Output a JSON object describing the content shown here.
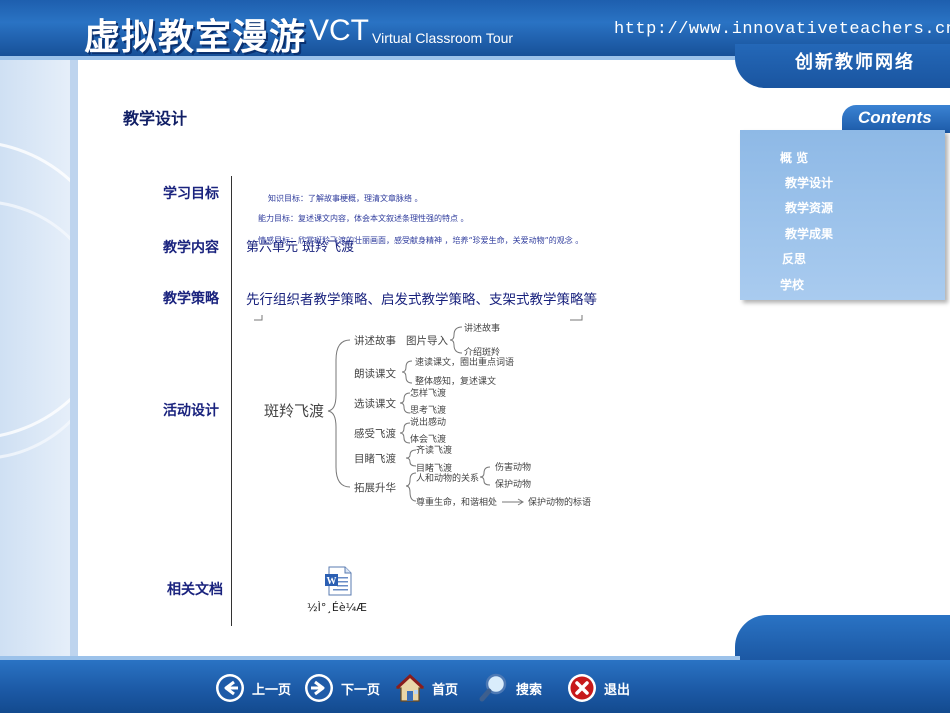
{
  "header": {
    "title_cn": "虚拟教室漫游",
    "title_short": "VCT",
    "title_en": "Virtual Classroom Tour",
    "url": "http://www.innovativeteachers.cn",
    "site_name": "创新教师网络"
  },
  "contents": {
    "title": "Contents",
    "items": [
      {
        "label": "概  览"
      },
      {
        "label": "教学设计"
      },
      {
        "label": "教学资源"
      },
      {
        "label": "教学成果"
      },
      {
        "label": "反思"
      },
      {
        "label": "学校"
      }
    ]
  },
  "main": {
    "page_title": "教学设计",
    "labels": {
      "goals": "学习目标",
      "content": "教学内容",
      "strategy": "教学策略",
      "activity": "活动设计",
      "docs": "相关文档"
    },
    "goals": [
      "知识目标：了解故事梗概，理清文章脉络 。",
      "能力目标：复述课文内容，体会本文叙述条理性强的特点 。",
      "情感目标：欣赏斑羚飞渡的壮丽画面，感受献身精神 ，培养“珍爱生命，关爱动物”的观念 。"
    ],
    "content_text": "第六单元    斑羚飞渡",
    "strategy_text": "先行组织者教学策略、启发式教学策略、支架式教学策略等",
    "doc_name": "½Ì°¸Éè¼Æ"
  },
  "mindmap": {
    "root": "斑羚飞渡",
    "branches": [
      "讲述故事",
      "朗读课文",
      "选读课文",
      "感受飞渡",
      "目睹飞渡",
      "拓展升华"
    ],
    "story_sub": "图片导入",
    "story_leaves": [
      "讲述故事",
      "介绍斑羚"
    ],
    "read_leaves": [
      "速读课文，圈出重点词语",
      "整体感知，复述课文"
    ],
    "select_leaves": [
      "怎样飞渡",
      "思考飞渡"
    ],
    "feel_leaves": [
      "说出感动",
      "体会飞渡"
    ],
    "witness_leaves": [
      "齐读飞渡",
      "目睹飞渡"
    ],
    "extend_relation": "人和动物的关系",
    "relation_leaves": [
      "伤害动物",
      "保护动物"
    ],
    "extend_respect": "尊重生命，和谐相处",
    "extend_target": "保护动物的标语"
  },
  "footer": {
    "prev": "上一页",
    "next": "下一页",
    "home": "首页",
    "search": "搜索",
    "exit": "退出"
  },
  "colors": {
    "header_blue": "#1e5fae",
    "label_navy": "#1a237e",
    "panel_blue": "#8eb9e6"
  }
}
